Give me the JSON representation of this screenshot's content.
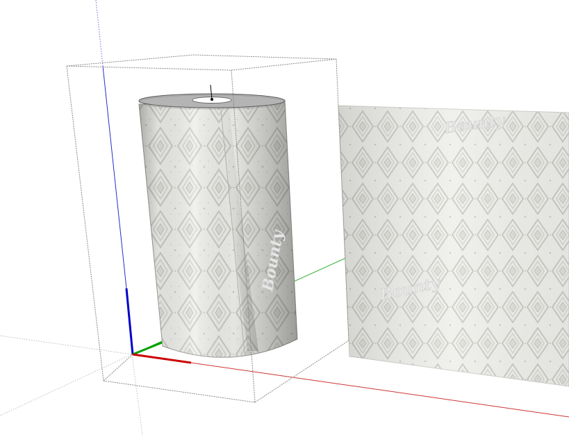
{
  "viewport": {
    "name": "3d-modeling-viewport",
    "background_color": "#ffffff"
  },
  "axes": {
    "x_color": "#cc0000",
    "y_color": "#00a000",
    "z_color": "#0000cc"
  },
  "model": {
    "selection_box_color": "#888888",
    "towel_pattern": "diamond-emboss",
    "brand_mark": "Bounty",
    "inference_marker_color": "#000000"
  },
  "colors": {
    "paper_light": "#f5f5f2",
    "paper_mid": "#d9d9d5",
    "paper_dark": "#9c9c98",
    "cap_top": "#b8b8b8"
  }
}
